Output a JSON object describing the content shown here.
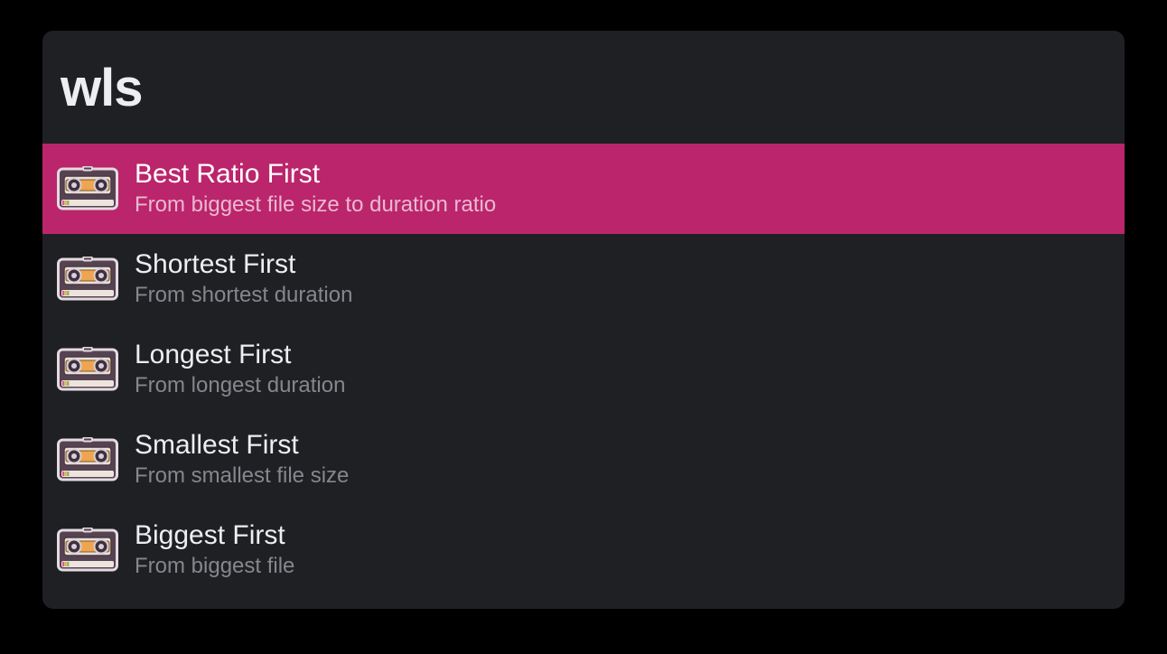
{
  "header": {
    "title": "wls"
  },
  "colors": {
    "accent": "#bb256c",
    "panel": "#1f2023",
    "text_primary": "#eceef0",
    "text_secondary": "#84878c",
    "selected_sub": "#eab9d1"
  },
  "items": [
    {
      "icon": "vhs-tape-icon",
      "title": "Best Ratio First",
      "subtitle": "From biggest file size to duration ratio",
      "selected": true
    },
    {
      "icon": "vhs-tape-icon",
      "title": "Shortest First",
      "subtitle": "From shortest duration",
      "selected": false
    },
    {
      "icon": "vhs-tape-icon",
      "title": "Longest First",
      "subtitle": "From longest duration",
      "selected": false
    },
    {
      "icon": "vhs-tape-icon",
      "title": "Smallest First",
      "subtitle": "From smallest file size",
      "selected": false
    },
    {
      "icon": "vhs-tape-icon",
      "title": "Biggest First",
      "subtitle": "From biggest file",
      "selected": false
    }
  ]
}
